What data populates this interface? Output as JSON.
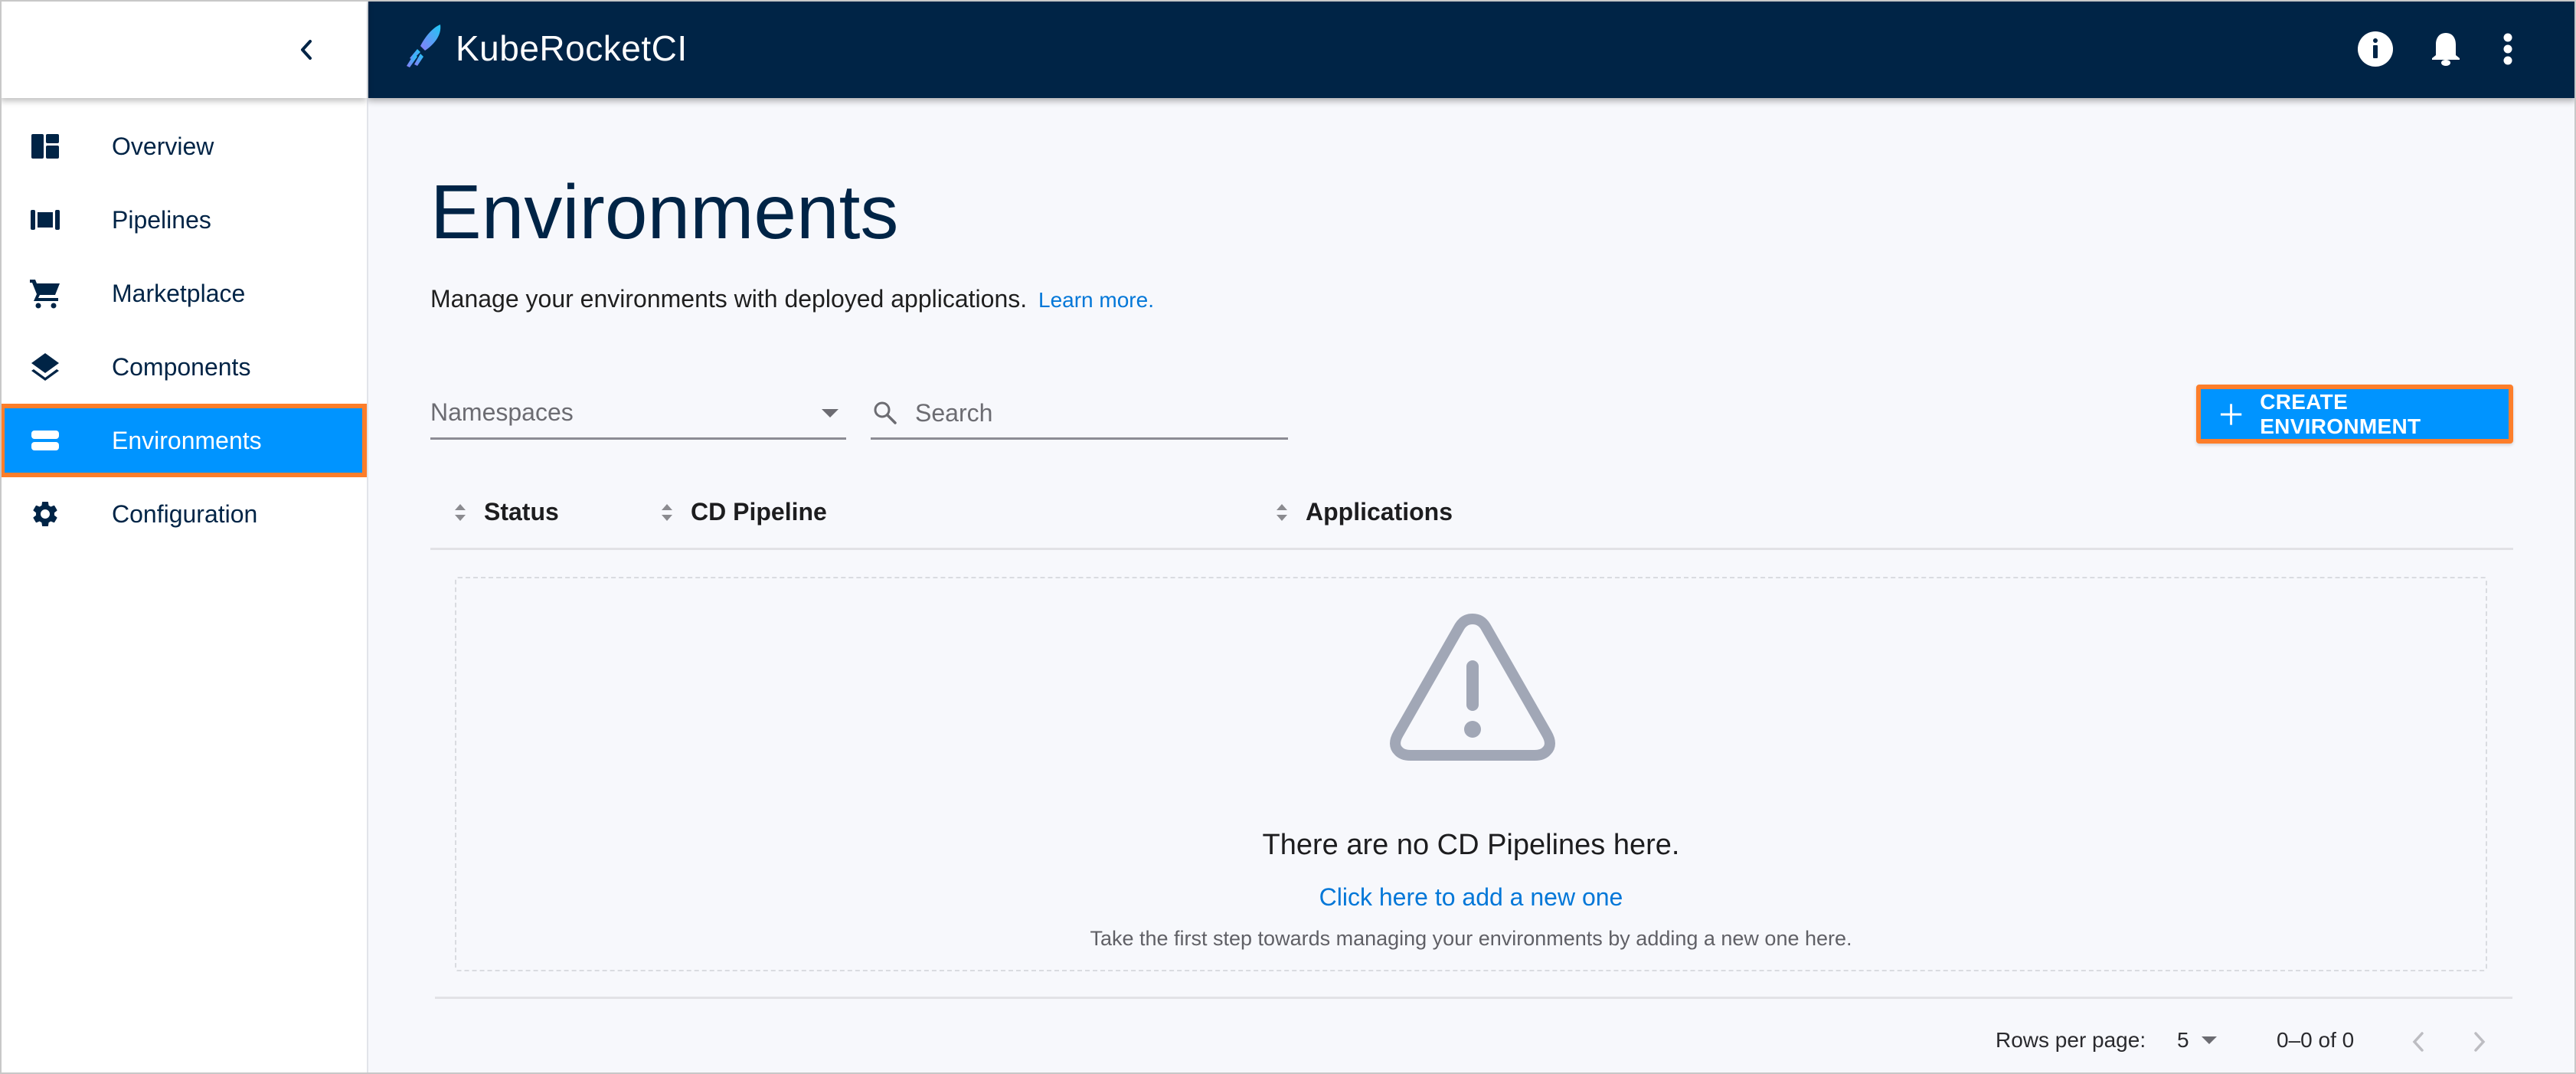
{
  "sidebar": {
    "collapse_icon": "chevron-left-icon",
    "items": [
      {
        "label": "Overview",
        "icon": "dashboard-icon",
        "active": false
      },
      {
        "label": "Pipelines",
        "icon": "pipelines-icon",
        "active": false
      },
      {
        "label": "Marketplace",
        "icon": "cart-icon",
        "active": false
      },
      {
        "label": "Components",
        "icon": "layers-icon",
        "active": false
      },
      {
        "label": "Environments",
        "icon": "environments-icon",
        "active": true
      },
      {
        "label": "Configuration",
        "icon": "gear-icon",
        "active": false
      }
    ]
  },
  "header": {
    "brand": "KubeRocketCI",
    "logo_icon": "rocket-logo-icon",
    "icons": [
      "info-icon",
      "bell-icon",
      "more-vertical-icon"
    ]
  },
  "page": {
    "title": "Environments",
    "subtitle": "Manage your environments with deployed applications.",
    "learn_more": "Learn more."
  },
  "filters": {
    "namespaces_placeholder": "Namespaces",
    "search_placeholder": "Search",
    "search_value": ""
  },
  "actions": {
    "create_label": "CREATE ENVIRONMENT"
  },
  "table": {
    "columns": [
      "Status",
      "CD Pipeline",
      "Applications"
    ],
    "rows": []
  },
  "empty_state": {
    "icon": "warning-icon",
    "title": "There are no CD Pipelines here.",
    "link": "Click here to add a new one",
    "description": "Take the first step towards managing your environments by adding a new one here."
  },
  "pagination": {
    "rows_per_page_label": "Rows per page:",
    "rows_per_page": "5",
    "range": "0–0 of 0"
  },
  "colors": {
    "header_bg": "#002446",
    "accent": "#0094ff",
    "highlight": "#fd7e2a",
    "link": "#0277d8",
    "page_bg": "#f7f8fc"
  }
}
